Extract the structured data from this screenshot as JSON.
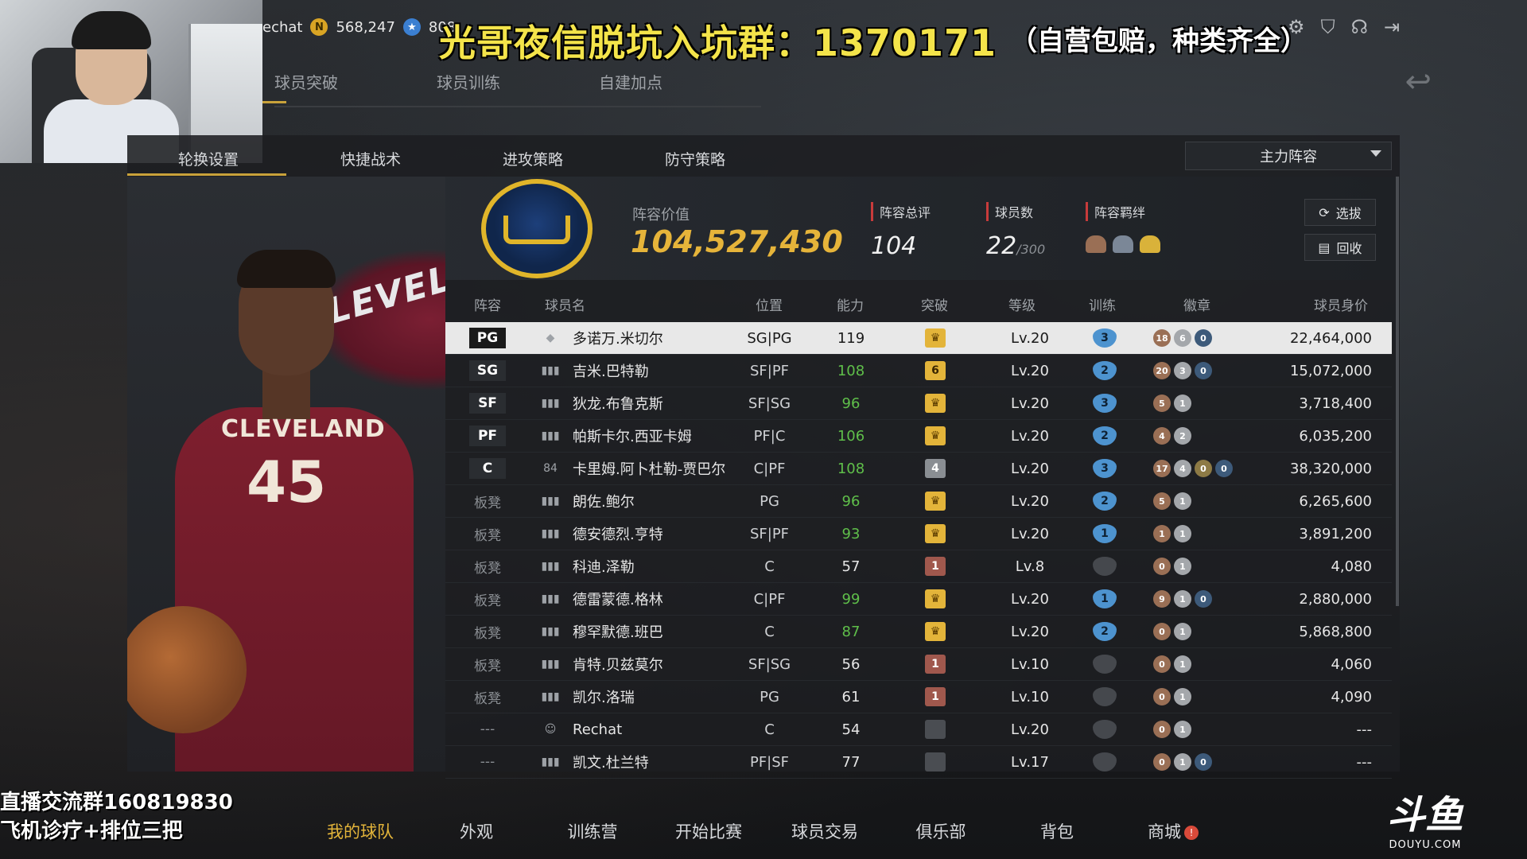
{
  "topbar": {
    "username": "echat",
    "coins": "568,247",
    "stars": "808"
  },
  "promo": {
    "main": "光哥夜信脱坑入坑群：1370171",
    "sub": "（自营包赔，种类齐全）"
  },
  "subtabs": [
    "球员突破",
    "球员训练",
    "自建加点"
  ],
  "navtabs": [
    "轮换设置",
    "快捷战术",
    "进攻策略",
    "防守策略"
  ],
  "lineup_select": "主力阵容",
  "summary": {
    "value_label": "阵容价值",
    "value": "104,527,430",
    "rating_label": "阵容总评",
    "rating": "104",
    "count_label": "球员数",
    "count": "22",
    "count_max": "/300",
    "bond_label": "阵容羁绊",
    "btn_select": "选拔",
    "btn_recycle": "回收"
  },
  "table": {
    "headers": {
      "lineup": "阵容",
      "name": "球员名",
      "position": "位置",
      "ability": "能力",
      "breakthrough": "突破",
      "level": "等级",
      "training": "训练",
      "badges": "徽章",
      "price": "球员身价"
    },
    "rows": [
      {
        "slot": "PG",
        "sig": "◆",
        "name": "多诺万.米切尔",
        "pos": "SG|PG",
        "ability": "119",
        "bt": "♛",
        "lv": "Lv.20",
        "tr": "3",
        "b1": "18",
        "b2": "6",
        "b3": "0",
        "price": "22,464,000"
      },
      {
        "slot": "SG",
        "sig": "▮▮▮",
        "name": "吉米.巴特勒",
        "pos": "SF|PF",
        "ability": "108",
        "bt": "6",
        "lv": "Lv.20",
        "tr": "2",
        "b1": "20",
        "b2": "3",
        "b3": "0",
        "price": "15,072,000"
      },
      {
        "slot": "SF",
        "sig": "▮▮▮",
        "name": "狄龙.布鲁克斯",
        "pos": "SF|SG",
        "ability": "96",
        "bt": "♛",
        "lv": "Lv.20",
        "tr": "3",
        "b1": "5",
        "b2": "1",
        "price": "3,718,400"
      },
      {
        "slot": "PF",
        "sig": "▮▮▮",
        "name": "帕斯卡尔.西亚卡姆",
        "pos": "PF|C",
        "ability": "106",
        "bt": "♛",
        "lv": "Lv.20",
        "tr": "2",
        "b1": "4",
        "b2": "2",
        "price": "6,035,200"
      },
      {
        "slot": "C",
        "sig": "84",
        "name": "卡里姆.阿卜杜勒-贾巴尔",
        "pos": "C|PF",
        "ability": "108",
        "bt": "4",
        "lv": "Lv.20",
        "tr": "3",
        "b1": "17",
        "b2": "4",
        "b3": "0",
        "b4": "0",
        "price": "38,320,000"
      },
      {
        "slot": "板凳",
        "sig": "▮▮▮",
        "name": "朗佐.鲍尔",
        "pos": "PG",
        "ability": "96",
        "bt": "♛",
        "lv": "Lv.20",
        "tr": "2",
        "b1": "5",
        "b2": "1",
        "price": "6,265,600"
      },
      {
        "slot": "板凳",
        "sig": "▮▮▮",
        "name": "德安德烈.亨特",
        "pos": "SF|PF",
        "ability": "93",
        "bt": "♛",
        "lv": "Lv.20",
        "tr": "1",
        "b1": "1",
        "b2": "1",
        "price": "3,891,200"
      },
      {
        "slot": "板凳",
        "sig": "▮▮▮",
        "name": "科迪.泽勒",
        "pos": "C",
        "ability": "57",
        "bt": "1",
        "lv": "Lv.8",
        "tr": "",
        "b1": "0",
        "b2": "1",
        "price": "4,080"
      },
      {
        "slot": "板凳",
        "sig": "▮▮▮",
        "name": "德雷蒙德.格林",
        "pos": "C|PF",
        "ability": "99",
        "bt": "♛",
        "lv": "Lv.20",
        "tr": "1",
        "b1": "9",
        "b2": "1",
        "b3": "0",
        "price": "2,880,000"
      },
      {
        "slot": "板凳",
        "sig": "▮▮▮",
        "name": "穆罕默德.班巴",
        "pos": "C",
        "ability": "87",
        "bt": "♛",
        "lv": "Lv.20",
        "tr": "2",
        "b1": "0",
        "b2": "1",
        "price": "5,868,800"
      },
      {
        "slot": "板凳",
        "sig": "▮▮▮",
        "name": "肯特.贝兹莫尔",
        "pos": "SF|SG",
        "ability": "56",
        "bt": "1",
        "lv": "Lv.10",
        "tr": "",
        "b1": "0",
        "b2": "1",
        "price": "4,060"
      },
      {
        "slot": "板凳",
        "sig": "▮▮▮",
        "name": "凯尔.洛瑞",
        "pos": "PG",
        "ability": "61",
        "bt": "1",
        "lv": "Lv.10",
        "tr": "",
        "b1": "0",
        "b2": "1",
        "price": "4,090"
      },
      {
        "slot": "---",
        "sig": "☺",
        "name": "Rechat",
        "pos": "C",
        "ability": "54",
        "bt": "",
        "lv": "Lv.20",
        "tr": "",
        "b1": "0",
        "b2": "1",
        "price": "---"
      },
      {
        "slot": "---",
        "sig": "▮▮▮",
        "name": "凯文.杜兰特",
        "pos": "PF|SF",
        "ability": "77",
        "bt": "",
        "lv": "Lv.17",
        "tr": "",
        "b1": "0",
        "b2": "1",
        "b3": "0",
        "price": "---"
      }
    ]
  },
  "player_art": {
    "banner_text": "CLEVELAN",
    "jersey_text": "CLEVELAND",
    "jersey_number": "45"
  },
  "bottomnav": [
    "我的球队",
    "外观",
    "训练营",
    "开始比赛",
    "球员交易",
    "俱乐部",
    "背包",
    "商城"
  ],
  "overlay": {
    "line1": "直播交流群160819830",
    "line2": "飞机诊疗+排位三把"
  },
  "watermark": {
    "mark": "斗鱼",
    "sub": "DOUYU.COM"
  }
}
